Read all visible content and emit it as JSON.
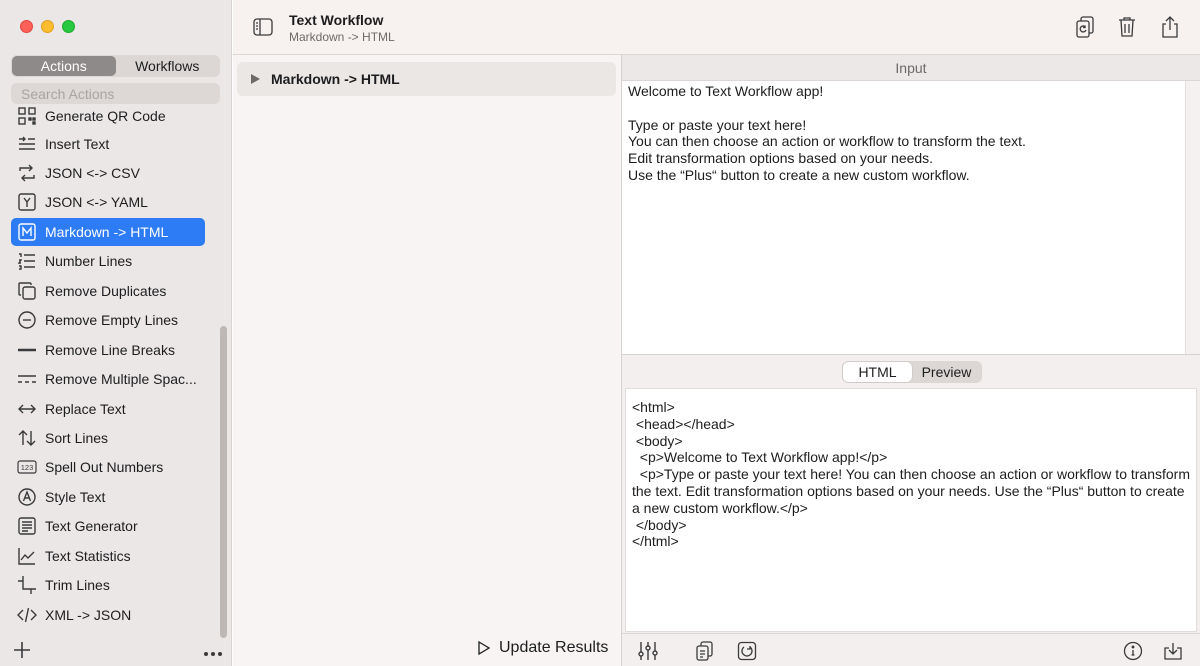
{
  "sidebar": {
    "tabs": [
      {
        "label": "Actions",
        "active": true
      },
      {
        "label": "Workflows",
        "active": false
      }
    ],
    "search_placeholder": "Search Actions",
    "items": [
      {
        "label": "Generate QR Code",
        "icon": "qr-code-icon"
      },
      {
        "label": "Insert Text",
        "icon": "insert-text-icon"
      },
      {
        "label": "JSON <-> CSV",
        "icon": "convert-arrows-icon"
      },
      {
        "label": "JSON <-> YAML",
        "icon": "y-square-icon"
      },
      {
        "label": "Markdown -> HTML",
        "icon": "m-square-icon",
        "selected": true
      },
      {
        "label": "Number Lines",
        "icon": "numbered-list-icon"
      },
      {
        "label": "Remove Duplicates",
        "icon": "duplicate-icon"
      },
      {
        "label": "Remove Empty Lines",
        "icon": "minus-circle-icon"
      },
      {
        "label": "Remove Line Breaks",
        "icon": "line-icon"
      },
      {
        "label": "Remove Multiple Spac...",
        "icon": "dashed-lines-icon"
      },
      {
        "label": "Replace Text",
        "icon": "left-right-arrow-icon"
      },
      {
        "label": "Sort Lines",
        "icon": "sort-arrows-icon"
      },
      {
        "label": "Spell Out Numbers",
        "icon": "123-icon"
      },
      {
        "label": "Style Text",
        "icon": "a-circle-icon"
      },
      {
        "label": "Text Generator",
        "icon": "text-doc-icon"
      },
      {
        "label": "Text Statistics",
        "icon": "chart-line-icon"
      },
      {
        "label": "Trim Lines",
        "icon": "crop-icon"
      },
      {
        "label": "XML -> JSON",
        "icon": "code-icon"
      }
    ]
  },
  "toolbar": {
    "title": "Text Workflow",
    "subtitle": "Markdown -> HTML"
  },
  "workflow": {
    "step_label": "Markdown -> HTML",
    "update_label": "Update Results"
  },
  "input": {
    "header": "Input",
    "text": "Welcome to Text Workflow app!\n\nType or paste your text here!\nYou can then choose an action or workflow to transform the text.\nEdit transformation options based on your needs.\nUse the “Plus“ button to create a new custom workflow."
  },
  "output": {
    "tabs": [
      {
        "label": "HTML",
        "active": true
      },
      {
        "label": "Preview",
        "active": false
      }
    ],
    "text": "<html>\n <head></head>\n <body>\n  <p>Welcome to Text Workflow app!</p>\n  <p>Type or paste your text here! You can then choose an action or workflow to transform the text. Edit transformation options based on your needs. Use the “Plus“ button to create a new custom workflow.</p>\n </body>\n</html>"
  },
  "colors": {
    "accent": "#2e7bf6",
    "sidebar_bg": "#ebe7e6",
    "toolbar_bg": "#f7f1ef"
  }
}
